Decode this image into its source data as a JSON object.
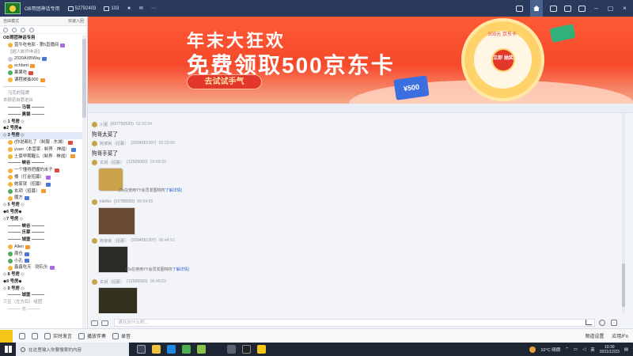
{
  "topbar": {
    "title": "OB哥团神话专用",
    "channel_id": "52792403",
    "online_count": "103"
  },
  "left_panel": {
    "mode_label": "自由模式",
    "join_label": "快速入团"
  },
  "tree": [
    {
      "t": "OB哥团神话专用",
      "kind": "grp",
      "ind": 0
    },
    {
      "t": "蓝牛吃电影 - 第5直播间",
      "kind": "user",
      "ind": 1,
      "av": "y",
      "badge": "p"
    },
    {
      "t": "【超人邮件申请】",
      "kind": "muted",
      "ind": 1
    },
    {
      "t": "2020AXBWay",
      "kind": "user",
      "ind": 1,
      "av": "",
      "badge": "b"
    },
    {
      "t": "echbert",
      "kind": "user",
      "ind": 1,
      "av": "y",
      "badge": "o"
    },
    {
      "t": "果果吃",
      "kind": "user",
      "ind": 1,
      "av": "g",
      "badge": "r"
    },
    {
      "t": "课程被抽300",
      "kind": "user",
      "ind": 1,
      "av": "y",
      "badge": "o"
    },
    {
      "t": "——————————",
      "kind": "muted",
      "ind": 0
    },
    {
      "t": "马克的铭牌",
      "kind": "muted",
      "ind": 1
    },
    {
      "t": "本频道自愿进出",
      "kind": "muted",
      "ind": 0
    },
    {
      "t": "——— 马钢 ———",
      "kind": "grp",
      "ind": 1
    },
    {
      "t": "——— 奥钢 ———",
      "kind": "grp",
      "ind": 1
    },
    {
      "t": "◇ 1 号房 ◇",
      "kind": "grp",
      "ind": 0
    },
    {
      "t": "◆2 号房◆",
      "kind": "grp",
      "ind": 0
    },
    {
      "t": "◇ 3 号房 ◇",
      "kind": "sel",
      "ind": 0
    },
    {
      "t": "(你说都扎了（制服 · 东城）",
      "kind": "user",
      "ind": 1,
      "av": "y",
      "badge": "r"
    },
    {
      "t": "yuan（本营家 · 制界 · 神战）",
      "kind": "user",
      "ind": 1,
      "av": "y",
      "badge": "b"
    },
    {
      "t": "土豪早期醒么（制界 · 神战）",
      "kind": "user",
      "ind": 1,
      "av": "y",
      "badge": "o"
    },
    {
      "t": "——— 峡谷 ———",
      "kind": "grp",
      "ind": 1
    },
    {
      "t": "一个懂得把握的米子",
      "kind": "user",
      "ind": 1,
      "av": "y",
      "badge": "r"
    },
    {
      "t": "楼（打金招募）",
      "kind": "user",
      "ind": 1,
      "av": "y",
      "badge": "p"
    },
    {
      "t": "她家就（招募）",
      "kind": "user",
      "ind": 1,
      "av": "y",
      "badge": "b"
    },
    {
      "t": "玄玥（招募）",
      "kind": "user",
      "ind": 1,
      "av": "g",
      "badge": "o"
    },
    {
      "t": "魔方",
      "kind": "user",
      "ind": 1,
      "av": "y",
      "badge": "b"
    },
    {
      "t": "◇ 5 号房 ◇",
      "kind": "grp",
      "ind": 0
    },
    {
      "t": "◆6 号房◆",
      "kind": "grp",
      "ind": 0
    },
    {
      "t": "◇7 号房 ◇",
      "kind": "grp",
      "ind": 0
    },
    {
      "t": "——— 峡谷 ———",
      "kind": "grp",
      "ind": 1
    },
    {
      "t": "——— 乐章 ———",
      "kind": "grp",
      "ind": 1
    },
    {
      "t": "——— 城堡 ———",
      "kind": "grp",
      "ind": 1
    },
    {
      "t": "Allen",
      "kind": "user",
      "ind": 1,
      "av": "y",
      "badge": "o"
    },
    {
      "t": "周仓",
      "kind": "user",
      "ind": 1,
      "av": "g",
      "badge": "b"
    },
    {
      "t": "小孔",
      "kind": "user",
      "ind": 1,
      "av": "g",
      "badge": "b"
    },
    {
      "t": "鑫鑫吃天 · 铠石头",
      "kind": "user",
      "ind": 1,
      "av": "y",
      "badge": "p"
    },
    {
      "t": "◇ 8 号房 ◇",
      "kind": "grp",
      "ind": 0
    },
    {
      "t": "◆9 号房◆",
      "kind": "grp",
      "ind": 0
    },
    {
      "t": "◇ 0 号房 ◇",
      "kind": "grp",
      "ind": 0
    },
    {
      "t": "——— 城堡 ———",
      "kind": "grp",
      "ind": 1
    },
    {
      "t": "三区（左方后）· 组团",
      "kind": "muted",
      "ind": 0
    },
    {
      "t": "——— 光 ———",
      "kind": "muted",
      "ind": 1
    }
  ],
  "banner": {
    "line1": "年末大狂欢",
    "line2": "免费领取500京东卡",
    "button": "去试试手气",
    "card_text": "¥500",
    "wheel_top": "500元 京东卡",
    "wheel_center": "立即 抽奖"
  },
  "messages": [
    {
      "name": "川夏",
      "uid": "(837750520)",
      "time": "02:33:24",
      "text": "狗哥太菜了"
    },
    {
      "name": "她家就（招募）",
      "uid": "(2004551397)",
      "time": "02:33:50",
      "text": "狗哥手菜了"
    },
    {
      "name": "玄玥（招募）",
      "uid": "(12505060)",
      "time": "03:59:33",
      "text": "",
      "tip": "(Ta在使用YY会员发图特权",
      "tip_link": "了解详情)"
    },
    {
      "name": "kitefkz",
      "uid": "(10788590)",
      "time": "06:04:55",
      "text": ""
    },
    {
      "name": "她家就（招募）",
      "uid": "(2004551397)",
      "time": "06:44:51",
      "text": "",
      "tip": "(Ta在使用YY会员发图特权",
      "tip_link": "了解详情)"
    },
    {
      "name": "玄玥（招募）",
      "uid": "(12505060)",
      "time": "06:49:03",
      "text": ""
    }
  ],
  "input": {
    "placeholder": "请在这什么吧..."
  },
  "appbar": {
    "items": [
      "实时发言",
      "播放伴奏",
      "录音"
    ],
    "right": [
      "频道设置",
      "应用/Fn"
    ]
  },
  "taskbar": {
    "search_placeholder": "在这里输入你要搜索的内容",
    "weather": "10°C 晴朗",
    "lang": "英",
    "time": "10:30",
    "date": "2021/12/23"
  }
}
